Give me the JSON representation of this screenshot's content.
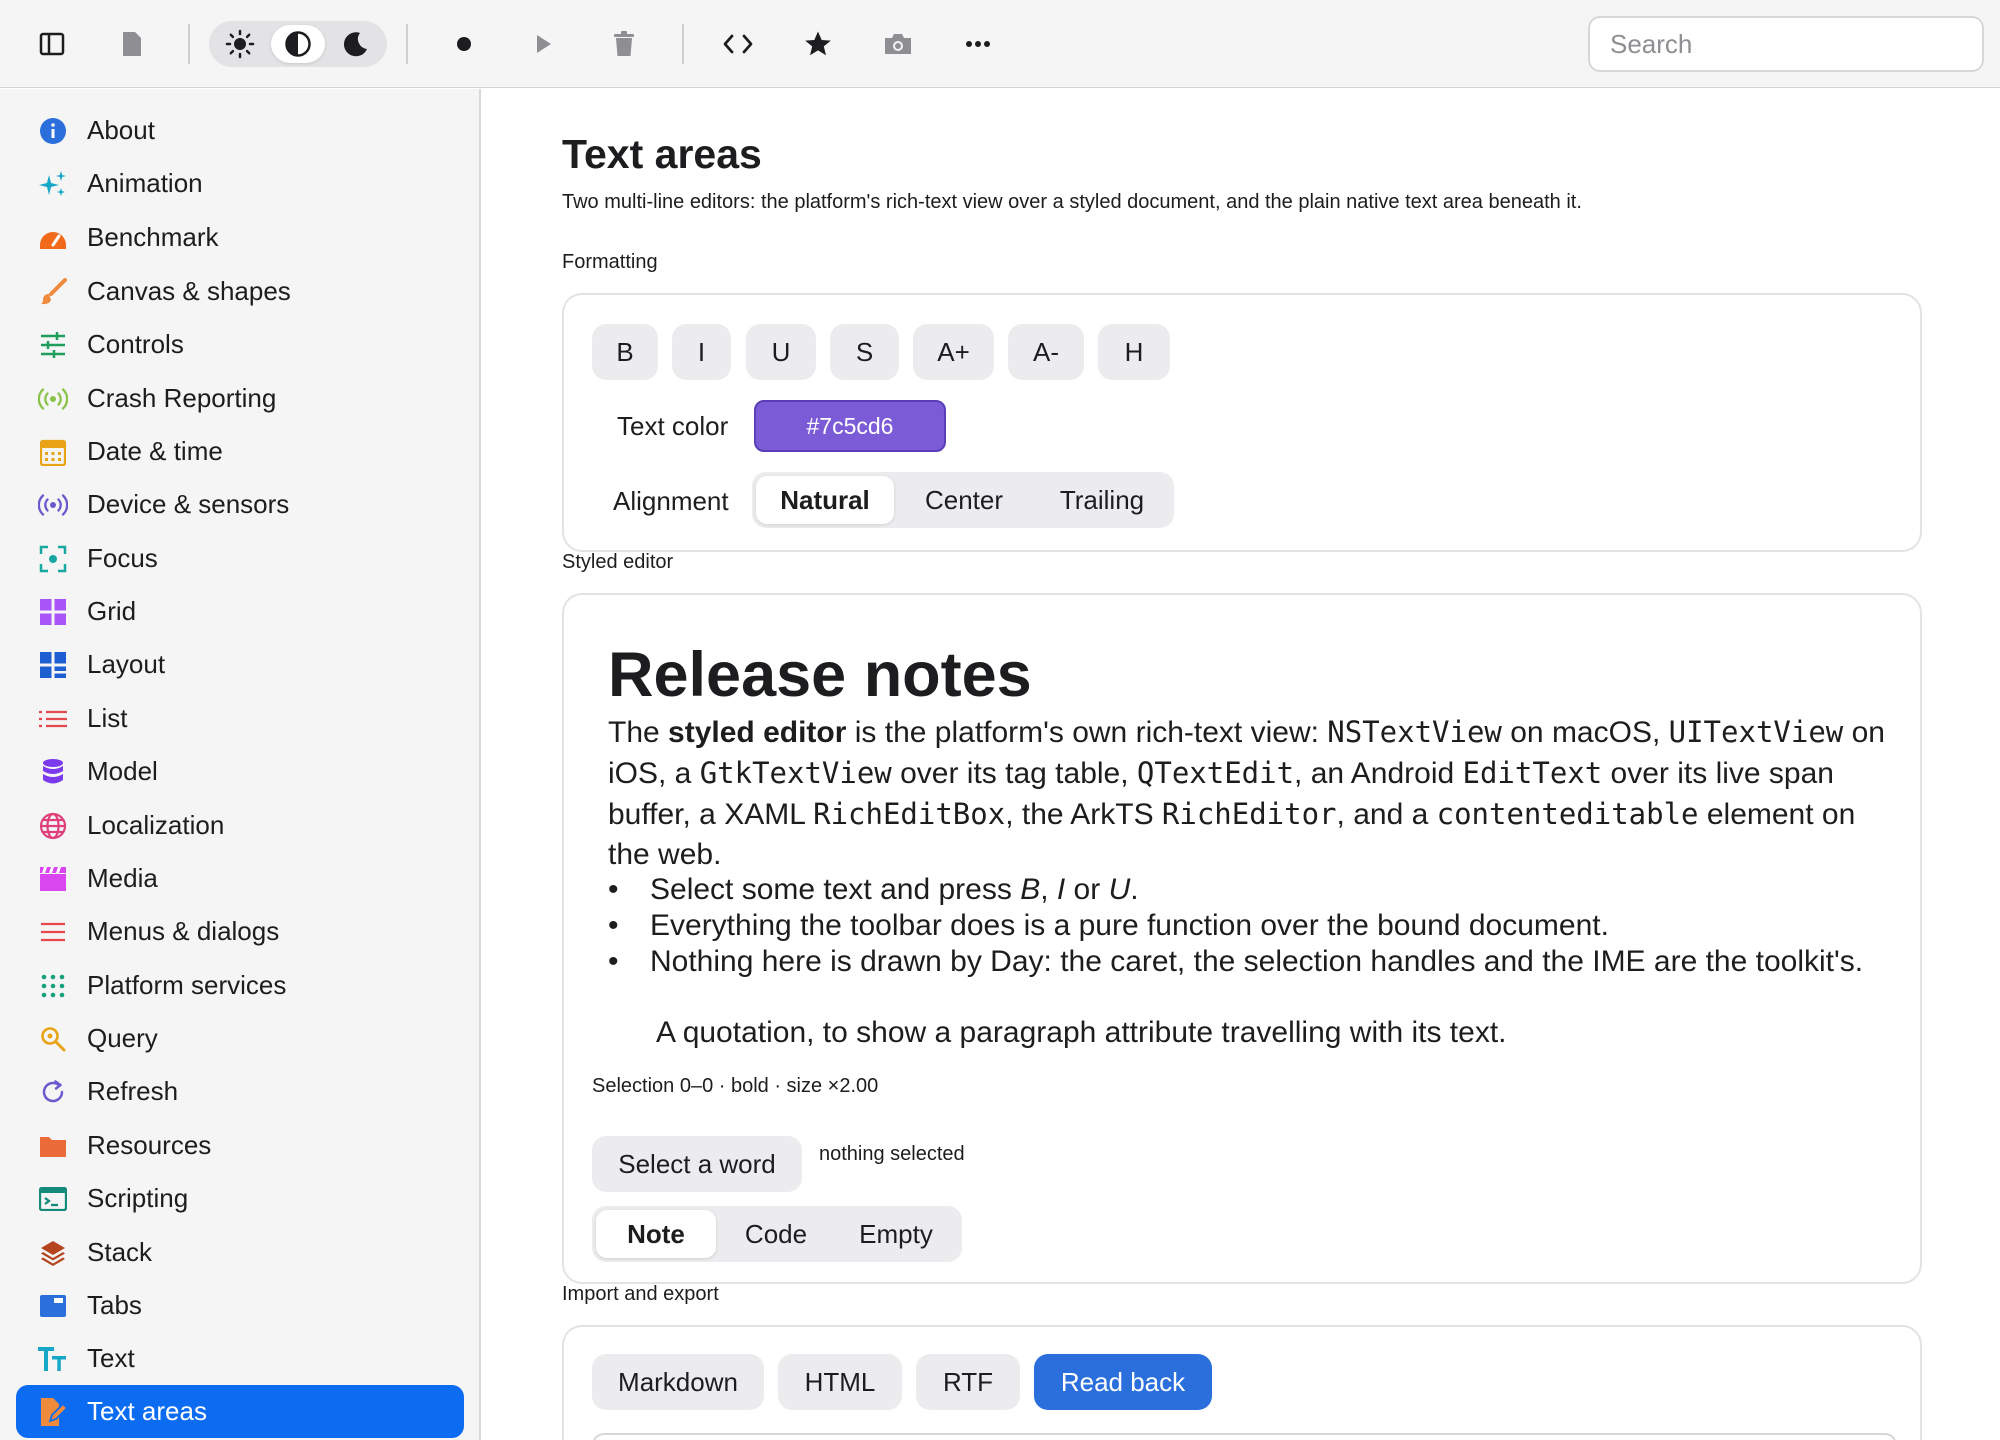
{
  "toolbar": {
    "search_placeholder": "Search",
    "icons": [
      "sidebar-toggle-icon",
      "document-icon",
      "sun-icon",
      "contrast-icon",
      "moon-icon",
      "record-icon",
      "play-icon",
      "trash-icon",
      "code-icon",
      "star-icon",
      "camera-icon",
      "more-icon"
    ],
    "theme_selected": "contrast"
  },
  "sidebar": {
    "items": [
      {
        "label": "About",
        "icon": "info-icon",
        "color": "#2b6fdc"
      },
      {
        "label": "Animation",
        "icon": "sparkles-icon",
        "color": "#17a7c7"
      },
      {
        "label": "Benchmark",
        "icon": "gauge-icon",
        "color": "#f06a1a"
      },
      {
        "label": "Canvas & shapes",
        "icon": "brush-icon",
        "color": "#f08a3c"
      },
      {
        "label": "Controls",
        "icon": "sliders-icon",
        "color": "#1e9e5a"
      },
      {
        "label": "Crash Reporting",
        "icon": "broadcast-icon",
        "color": "#8bc34a"
      },
      {
        "label": "Date & time",
        "icon": "calendar-icon",
        "color": "#e8a317"
      },
      {
        "label": "Device & sensors",
        "icon": "sensor-icon",
        "color": "#6a5acd"
      },
      {
        "label": "Focus",
        "icon": "focus-icon",
        "color": "#17a7a0"
      },
      {
        "label": "Grid",
        "icon": "grid-icon",
        "color": "#a855f7"
      },
      {
        "label": "Layout",
        "icon": "layout-icon",
        "color": "#1d5fd1"
      },
      {
        "label": "List",
        "icon": "list-icon",
        "color": "#e5484d"
      },
      {
        "label": "Model",
        "icon": "database-icon",
        "color": "#7c3aed"
      },
      {
        "label": "Localization",
        "icon": "globe-icon",
        "color": "#e0407a"
      },
      {
        "label": "Media",
        "icon": "clapper-icon",
        "color": "#d946ef"
      },
      {
        "label": "Menus & dialogs",
        "icon": "menu-icon",
        "color": "#e5484d"
      },
      {
        "label": "Platform services",
        "icon": "dots-grid-icon",
        "color": "#17a07a"
      },
      {
        "label": "Query",
        "icon": "magnifier-icon",
        "color": "#e8a317"
      },
      {
        "label": "Refresh",
        "icon": "refresh-icon",
        "color": "#6a5acd"
      },
      {
        "label": "Resources",
        "icon": "folder-icon",
        "color": "#ea6a3a"
      },
      {
        "label": "Scripting",
        "icon": "terminal-icon",
        "color": "#138a7a"
      },
      {
        "label": "Stack",
        "icon": "layers-icon",
        "color": "#b5441e"
      },
      {
        "label": "Tabs",
        "icon": "tabs-icon",
        "color": "#2b6fdc"
      },
      {
        "label": "Text",
        "icon": "text-icon",
        "color": "#17a7c7"
      },
      {
        "label": "Text areas",
        "icon": "edit-doc-icon",
        "color": "#f08a3c",
        "active": true
      }
    ]
  },
  "main": {
    "title": "Text areas",
    "subtitle": "Two multi-line editors: the platform's rich-text view over a styled document, and the plain native text area beneath it.",
    "formatting": {
      "label": "Formatting",
      "buttons": [
        "B",
        "I",
        "U",
        "S",
        "A+",
        "A-",
        "H"
      ],
      "text_color_label": "Text color",
      "text_color_value": "#7c5cd6",
      "alignment_label": "Alignment",
      "alignment_options": [
        "Natural",
        "Center",
        "Trailing"
      ],
      "alignment_selected": "Natural"
    },
    "styled_editor": {
      "label": "Styled editor",
      "heading": "Release notes",
      "body": {
        "p1": "The ",
        "p1_bold": "styled editor",
        "p2": " is the platform's own rich-text view: ",
        "c1": "NSTextView",
        "p3": " on macOS, ",
        "c2": "UITextView",
        "p4": " on iOS, a ",
        "c3": "GtkTextView",
        "p5": " over its tag table, ",
        "c4": "QTextEdit",
        "p6": ", an Android ",
        "c5": "EditText",
        "p7": " over its live span buffer, a XAML ",
        "c6": "RichEditBox",
        "p8": ", the ArkTS ",
        "c7": "RichEditor",
        "p9": ", and a ",
        "c8": "contenteditable",
        "p10": " element on the web."
      },
      "bullets": {
        "b1_a": "Select some text and press ",
        "b1_i1": "B",
        "b1_s1": ", ",
        "b1_i2": "I",
        "b1_s2": " or ",
        "b1_i3": "U",
        "b1_end": ".",
        "b2": "Everything the toolbar does is a pure function over the bound document.",
        "b3": "Nothing here is drawn by Day: the caret, the selection handles and the IME are the toolkit's."
      },
      "bullet_marker": "•",
      "quote": "A quotation, to show a paragraph attribute travelling with its text.",
      "selection_info": "Selection 0–0 · bold · size ×2.00",
      "select_word_button": "Select a word",
      "selection_note": "nothing selected",
      "content_options": [
        "Note",
        "Code",
        "Empty"
      ],
      "content_selected": "Note"
    },
    "import_export": {
      "label": "Import and export",
      "buttons": [
        "Markdown",
        "HTML",
        "RTF"
      ],
      "read_back_button": "Read back"
    }
  }
}
